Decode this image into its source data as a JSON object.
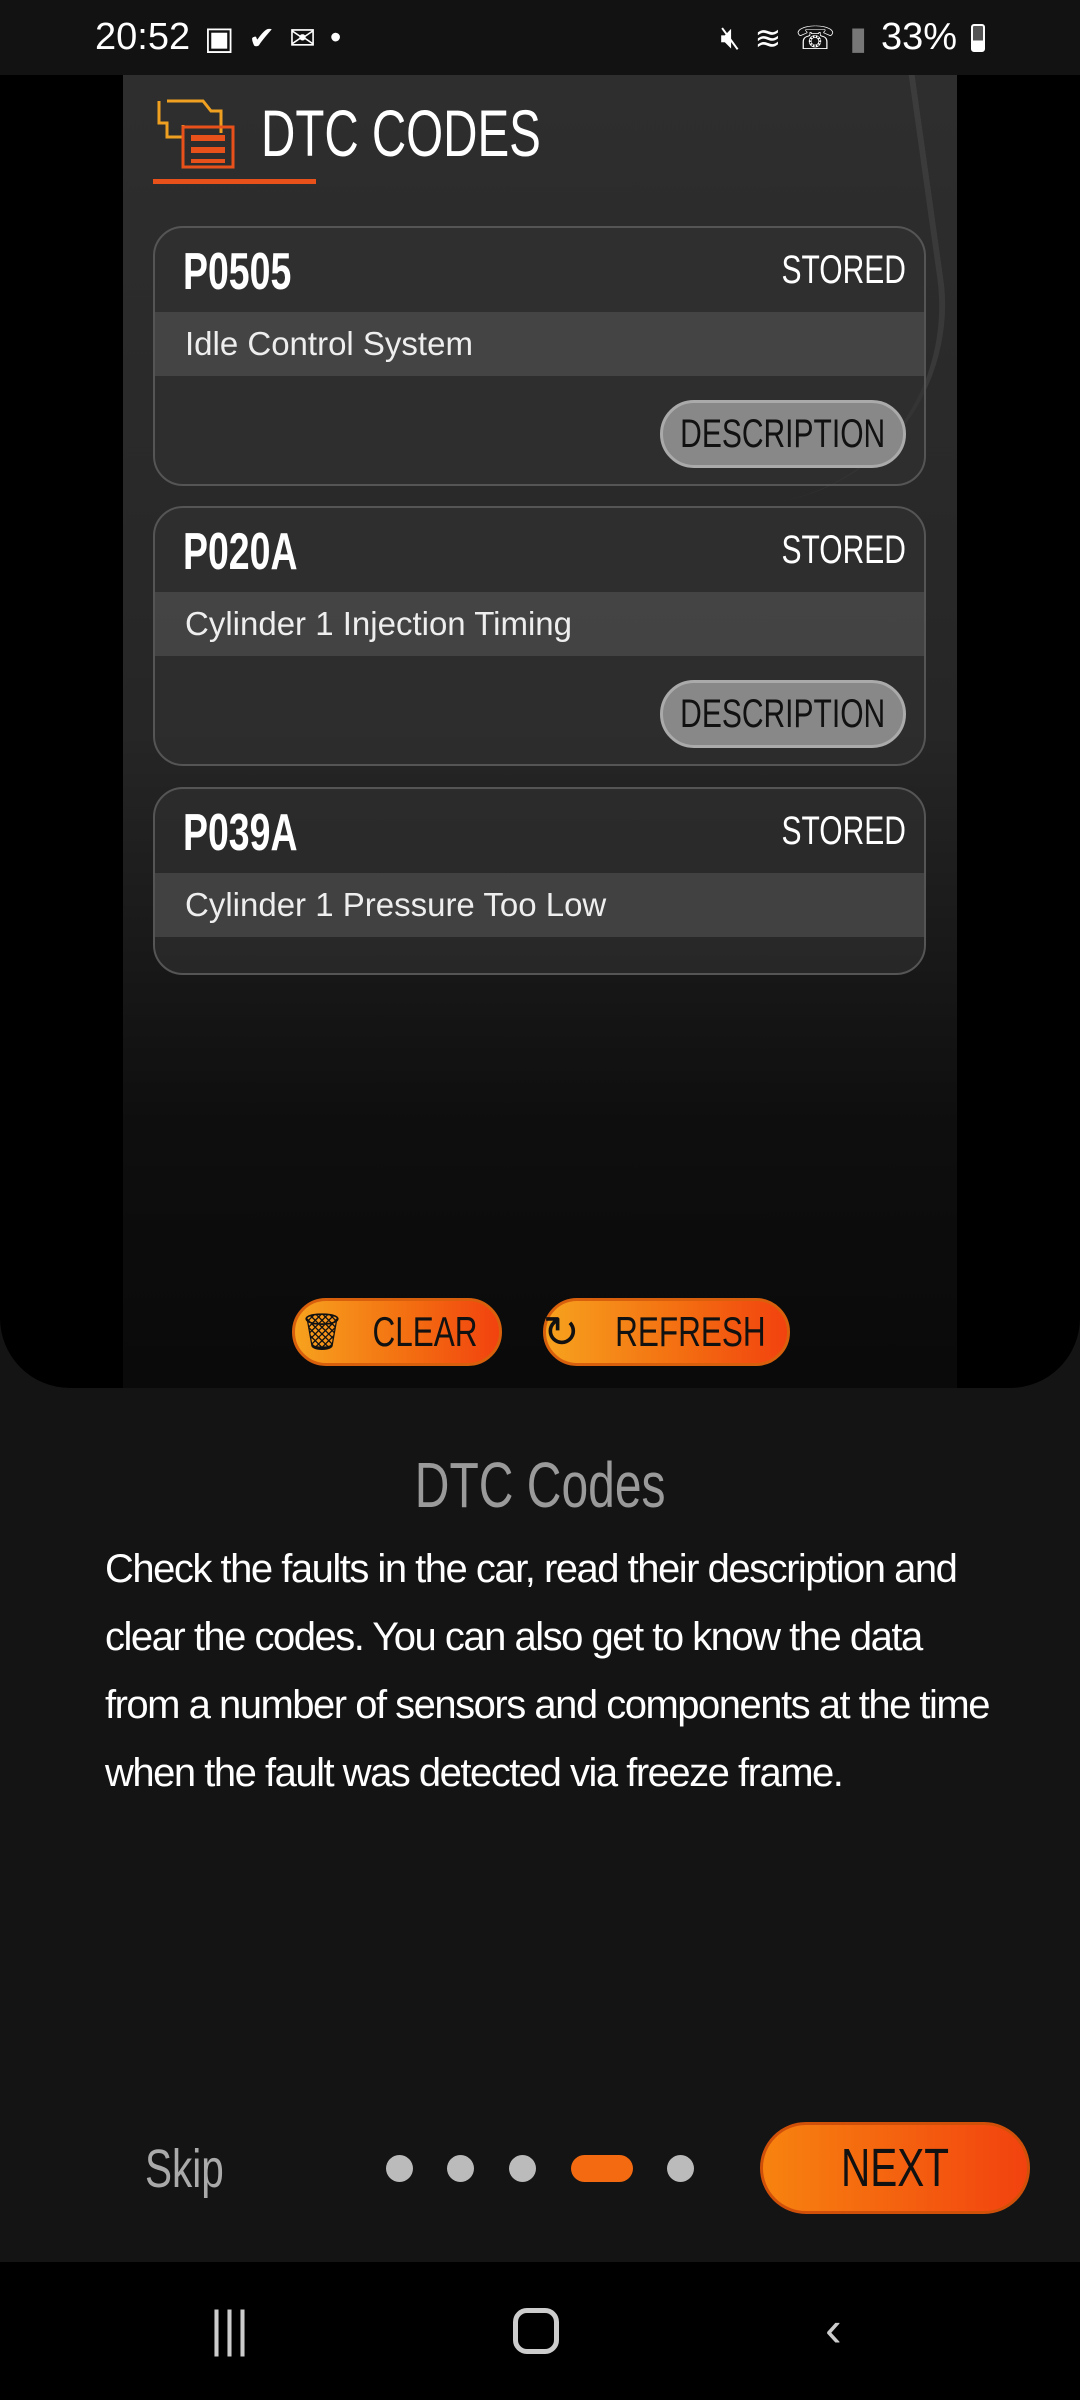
{
  "status_bar": {
    "time": "20:52",
    "battery": "33%",
    "icons_left": [
      "gallery-icon",
      "task-icon",
      "mail-icon",
      "dot-icon"
    ],
    "icons_right": [
      "mute-icon",
      "wifi-icon",
      "wifi-calling-icon",
      "signal-icon",
      "battery-icon"
    ]
  },
  "screen": {
    "title": "DTC CODES",
    "codes": [
      {
        "code": "P0505",
        "status": "STORED",
        "description": "Idle Control System",
        "button": "DESCRIPTION"
      },
      {
        "code": "P020A",
        "status": "STORED",
        "description": "Cylinder 1 Injection Timing",
        "button": "DESCRIPTION"
      },
      {
        "code": "P039A",
        "status": "STORED",
        "description": "Cylinder 1 Pressure Too Low"
      }
    ],
    "clear_label": "CLEAR",
    "refresh_label": "REFRESH"
  },
  "onboarding": {
    "title": "DTC Codes",
    "text": "Check the faults in the car, read their description and clear the codes. You can also get to know the data from a number of sensors and components at the time when the fault was detected via freeze frame.",
    "skip": "Skip",
    "next": "NEXT",
    "page_count": 5,
    "current_page": 4
  },
  "colors": {
    "accent": "#f36a10",
    "background": "#141414"
  }
}
